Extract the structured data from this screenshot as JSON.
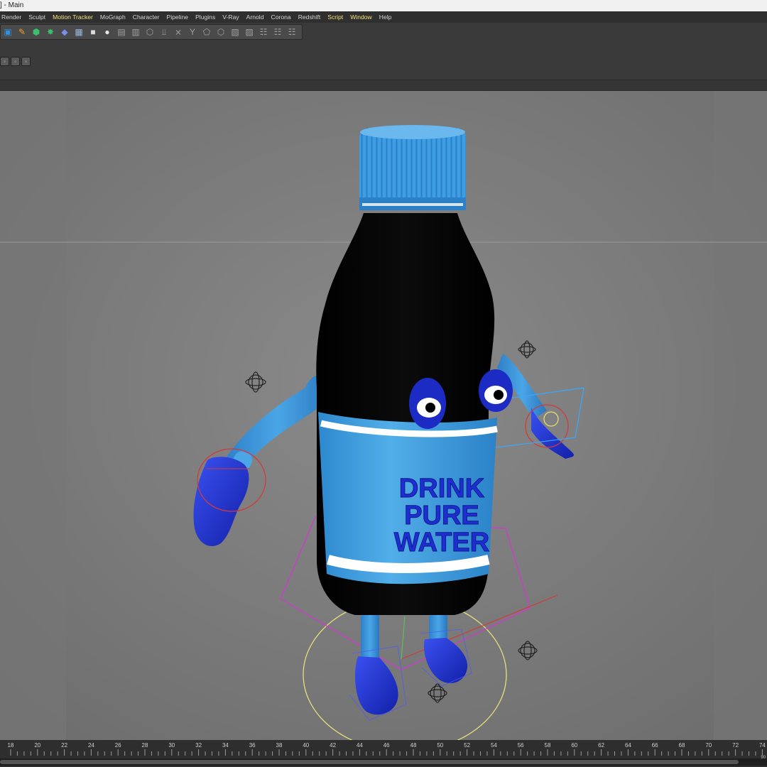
{
  "title": "] - Main",
  "menu": [
    {
      "label": "Render",
      "hl": false
    },
    {
      "label": "Sculpt",
      "hl": false
    },
    {
      "label": "Motion Tracker",
      "hl": true
    },
    {
      "label": "MoGraph",
      "hl": false
    },
    {
      "label": "Character",
      "hl": false
    },
    {
      "label": "Pipeline",
      "hl": false
    },
    {
      "label": "Plugins",
      "hl": false
    },
    {
      "label": "V-Ray",
      "hl": false
    },
    {
      "label": "Arnold",
      "hl": false
    },
    {
      "label": "Corona",
      "hl": false
    },
    {
      "label": "Redshift",
      "hl": false
    },
    {
      "label": "Script",
      "hl": true
    },
    {
      "label": "Window",
      "hl": true
    },
    {
      "label": "Help",
      "hl": false
    }
  ],
  "toolbar_icons": [
    {
      "name": "cube-icon",
      "glyph": "▣",
      "color": "#2f8fe0"
    },
    {
      "name": "pen-icon",
      "glyph": "✎",
      "color": "#f0a020"
    },
    {
      "name": "subdivision-icon",
      "glyph": "⬢",
      "color": "#3ac06a"
    },
    {
      "name": "array-icon",
      "glyph": "✸",
      "color": "#3ac06a"
    },
    {
      "name": "deformer-icon",
      "glyph": "◆",
      "color": "#7a8ef0"
    },
    {
      "name": "floor-icon",
      "glyph": "▦",
      "color": "#9ab8e0"
    },
    {
      "name": "camera-icon",
      "glyph": "■",
      "color": "#dcdcdc"
    },
    {
      "name": "light-icon",
      "glyph": "●",
      "color": "#e8e8e8"
    },
    {
      "name": "grid-icon-1",
      "glyph": "▤",
      "color": "#a0a0a0"
    },
    {
      "name": "tool-icon-2",
      "glyph": "▥",
      "color": "#a0a0a0"
    },
    {
      "name": "tool-icon-3",
      "glyph": "⬡",
      "color": "#a0a0a0"
    },
    {
      "name": "joint-icon",
      "glyph": "⫫",
      "color": "#a0a0a0"
    },
    {
      "name": "ik-icon",
      "glyph": "⨯",
      "color": "#a0a0a0"
    },
    {
      "name": "tool-icon-6",
      "glyph": "Y",
      "color": "#a0a0a0"
    },
    {
      "name": "tool-icon-7",
      "glyph": "⬠",
      "color": "#a0a0a0"
    },
    {
      "name": "tool-icon-8",
      "glyph": "⬡",
      "color": "#a0a0a0"
    },
    {
      "name": "tool-icon-9",
      "glyph": "▧",
      "color": "#a0a0a0"
    },
    {
      "name": "tool-icon-10",
      "glyph": "▨",
      "color": "#a0a0a0"
    },
    {
      "name": "tool-icon-11",
      "glyph": "☷",
      "color": "#a0a0a0"
    },
    {
      "name": "tool-icon-12",
      "glyph": "☷",
      "color": "#a0a0a0"
    },
    {
      "name": "tool-icon-13",
      "glyph": "☷",
      "color": "#a0a0a0"
    }
  ],
  "viewport": {
    "label_lines": [
      "DRINK",
      "PURE",
      "WATER"
    ]
  },
  "timeline": {
    "ticks": [
      "18",
      "20",
      "22",
      "24",
      "26",
      "28",
      "30",
      "32",
      "34",
      "36",
      "38",
      "40",
      "42",
      "44",
      "46",
      "48",
      "50",
      "52",
      "54",
      "56",
      "58",
      "60",
      "62",
      "64",
      "66",
      "68",
      "70",
      "72",
      "74"
    ],
    "corner_label": "90"
  },
  "colors": {
    "bottle_blue": "#3a9be0",
    "cap_blue": "#4aa6e6",
    "hand_blue": "#2435d6",
    "menu_highlight": "#f2e27a"
  }
}
